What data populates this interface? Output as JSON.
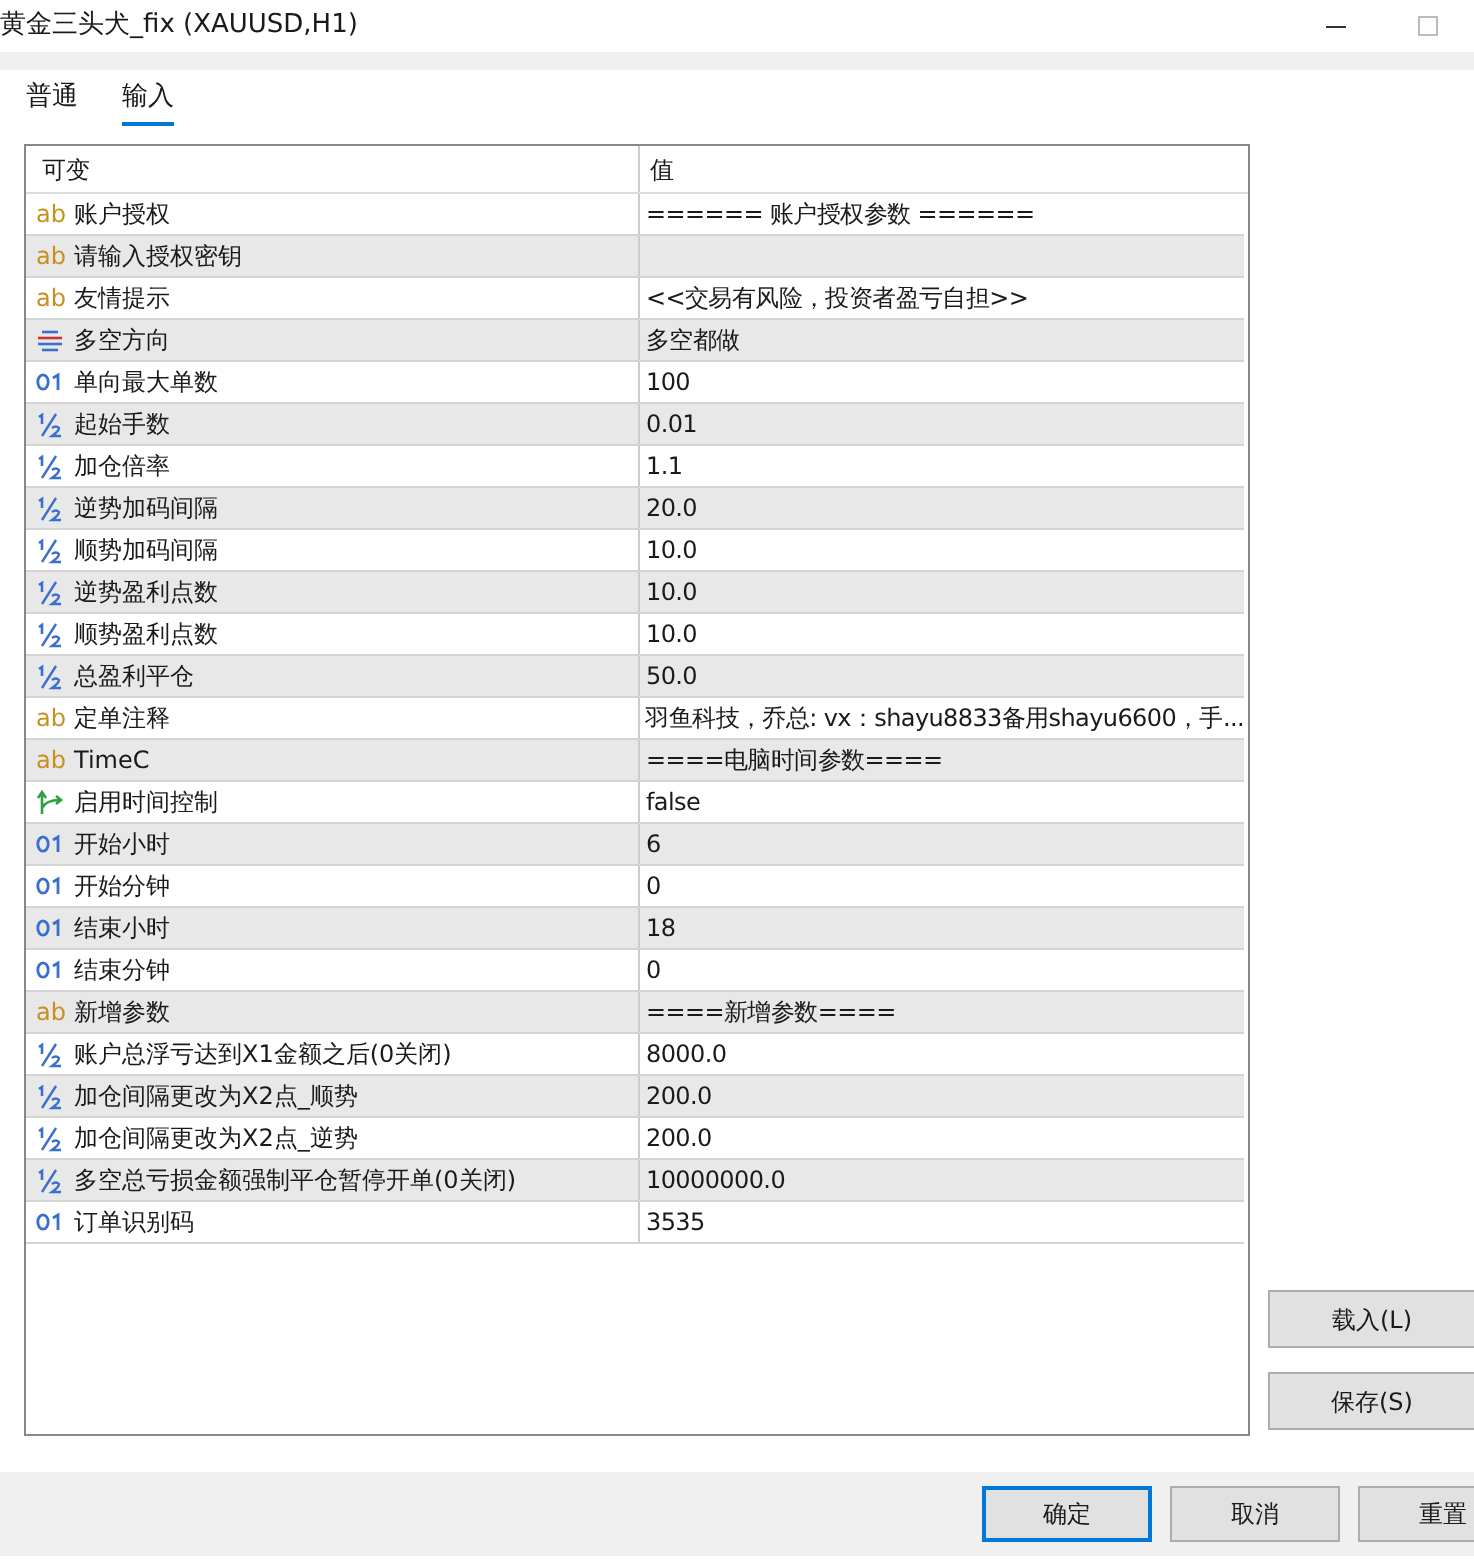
{
  "window": {
    "title": "黄金三头犬_fix (XAUUSD,H1)"
  },
  "tabs": [
    {
      "label": "普通",
      "selected": false
    },
    {
      "label": "输入",
      "selected": true
    }
  ],
  "table": {
    "columns": [
      "可变",
      "值"
    ],
    "rows": [
      {
        "kind": "string",
        "icon_text": "ab",
        "name": "账户授权",
        "value": "====== 账户授权参数 ======"
      },
      {
        "kind": "string",
        "icon_text": "ab",
        "name": "请输入授权密钥"
      },
      {
        "kind": "string",
        "icon_text": "ab",
        "name": "友情提示",
        "value": "<<交易有风险，投资者盈亏自担>>"
      },
      {
        "kind": "enum",
        "name": "多空方向",
        "value": "多空都做"
      },
      {
        "kind": "int",
        "name": "单向最大单数",
        "value": "100"
      },
      {
        "kind": "double",
        "name": "起始手数",
        "value": "0.01"
      },
      {
        "kind": "double",
        "name": "加仓倍率",
        "value": "1.1"
      },
      {
        "kind": "double",
        "name": "逆势加码间隔",
        "value": "20.0"
      },
      {
        "kind": "double",
        "name": "顺势加码间隔",
        "value": "10.0"
      },
      {
        "kind": "double",
        "name": "逆势盈利点数",
        "value": "10.0"
      },
      {
        "kind": "double",
        "name": "顺势盈利点数",
        "value": "10.0"
      },
      {
        "kind": "double",
        "name": "总盈利平仓",
        "value": "50.0"
      },
      {
        "kind": "string",
        "icon_text": "ab",
        "name": "定单注释",
        "value": "羽鱼科技，乔总: vx：shayu8833备用shayu6600，手..."
      },
      {
        "kind": "string",
        "icon_text": "ab",
        "name": "TimeC",
        "value": "====电脑时间参数===="
      },
      {
        "kind": "bool",
        "name": "启用时间控制",
        "value": "false"
      },
      {
        "kind": "int",
        "name": "开始小时",
        "value": "6"
      },
      {
        "kind": "int",
        "name": "开始分钟",
        "value": "0"
      },
      {
        "kind": "int",
        "name": "结束小时",
        "value": "18"
      },
      {
        "kind": "int",
        "name": "结束分钟",
        "value": "0"
      },
      {
        "kind": "string",
        "icon_text": "ab",
        "name": "新增参数",
        "value": "====新增参数===="
      },
      {
        "kind": "double",
        "name": "账户总浮亏达到X1金额之后(0关闭)",
        "value": "8000.0"
      },
      {
        "kind": "double",
        "name": "加仓间隔更改为X2点_顺势",
        "value": "200.0"
      },
      {
        "kind": "double",
        "name": "加仓间隔更改为X2点_逆势",
        "value": "200.0"
      },
      {
        "kind": "double",
        "name": "多空总亏损金额强制平仓暂停开单(0关闭)",
        "value": "10000000.0"
      },
      {
        "kind": "int",
        "name": "订单识别码",
        "value": "3535"
      }
    ]
  },
  "side_buttons": [
    "载入(L)",
    "保存(S)"
  ],
  "footer_buttons": [
    {
      "label": "确定",
      "selected": true
    },
    {
      "label": "取消",
      "selected": false
    },
    {
      "label": "重置",
      "selected": false
    }
  ]
}
